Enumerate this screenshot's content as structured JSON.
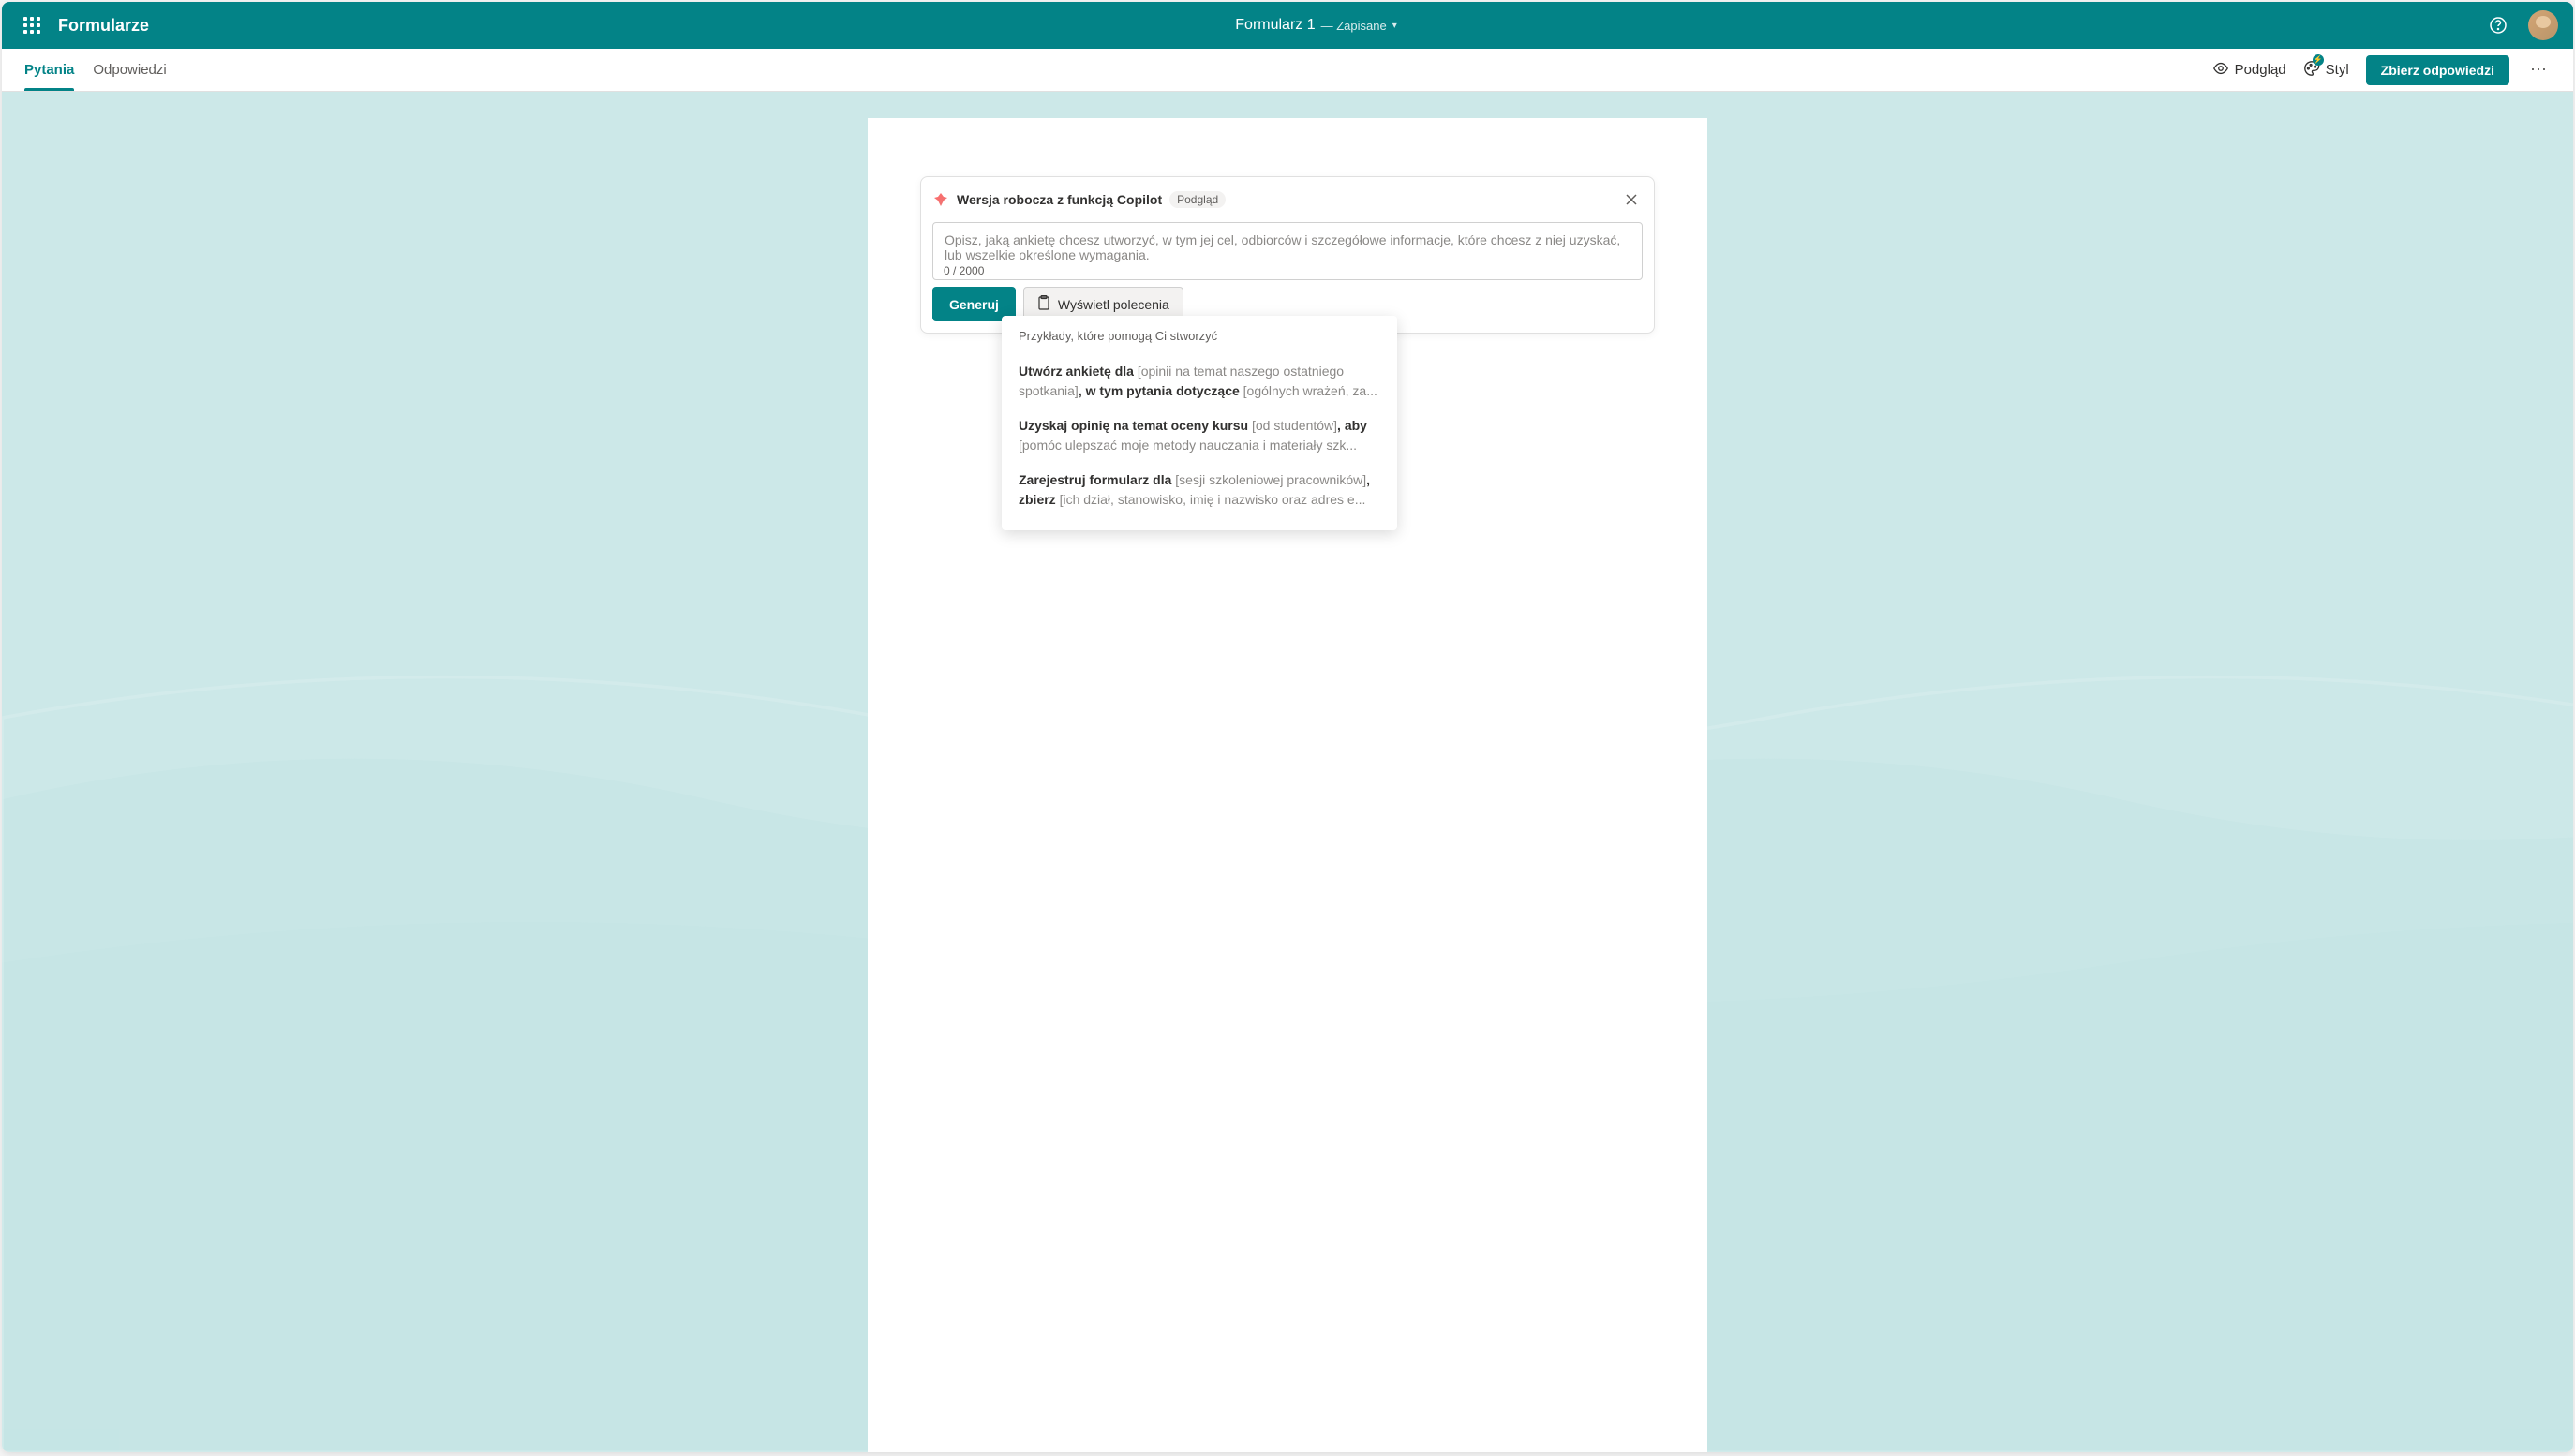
{
  "header": {
    "app_name": "Formularze",
    "doc_title": "Formularz 1",
    "doc_status": "— Zapisane"
  },
  "toolbar": {
    "tabs": [
      {
        "label": "Pytania",
        "active": true
      },
      {
        "label": "Odpowiedzi",
        "active": false
      }
    ],
    "preview_label": "Podgląd",
    "style_label": "Styl",
    "collect_label": "Zbierz odpowiedzi"
  },
  "copilot": {
    "title": "Wersja robocza z funkcją Copilot",
    "badge": "Podgląd",
    "placeholder": "Opisz, jaką ankietę chcesz utworzyć, w tym jej cel, odbiorców i szczegółowe informacje, które chcesz z niej uzyskać, lub wszelkie określone wymagania.",
    "char_counter": "0 / 2000",
    "generate_label": "Generuj",
    "show_prompts_label": "Wyświetl polecenia"
  },
  "prompts": {
    "header": "Przykłady, które pomogą Ci stworzyć",
    "items": [
      {
        "parts": [
          {
            "text": "Utwórz ankietę dla ",
            "type": "bold"
          },
          {
            "text": "[opinii na temat naszego ostatniego spotkania]",
            "type": "placeholder"
          },
          {
            "text": ", w tym pytania dotyczące ",
            "type": "bold"
          },
          {
            "text": "[ogólnych wrażeń, za...",
            "type": "placeholder"
          }
        ]
      },
      {
        "parts": [
          {
            "text": "Uzyskaj opinię na temat oceny kursu ",
            "type": "bold"
          },
          {
            "text": "[od studentów]",
            "type": "placeholder"
          },
          {
            "text": ", aby ",
            "type": "bold"
          },
          {
            "text": "[pomóc ulepszać moje metody nauczania i materiały szk...",
            "type": "placeholder"
          }
        ]
      },
      {
        "parts": [
          {
            "text": "Zarejestruj formularz dla ",
            "type": "bold"
          },
          {
            "text": "[sesji szkoleniowej pracowników]",
            "type": "placeholder"
          },
          {
            "text": ", zbierz ",
            "type": "bold"
          },
          {
            "text": "[ich dział, stanowisko, imię i nazwisko oraz adres e...",
            "type": "placeholder"
          }
        ]
      }
    ]
  }
}
